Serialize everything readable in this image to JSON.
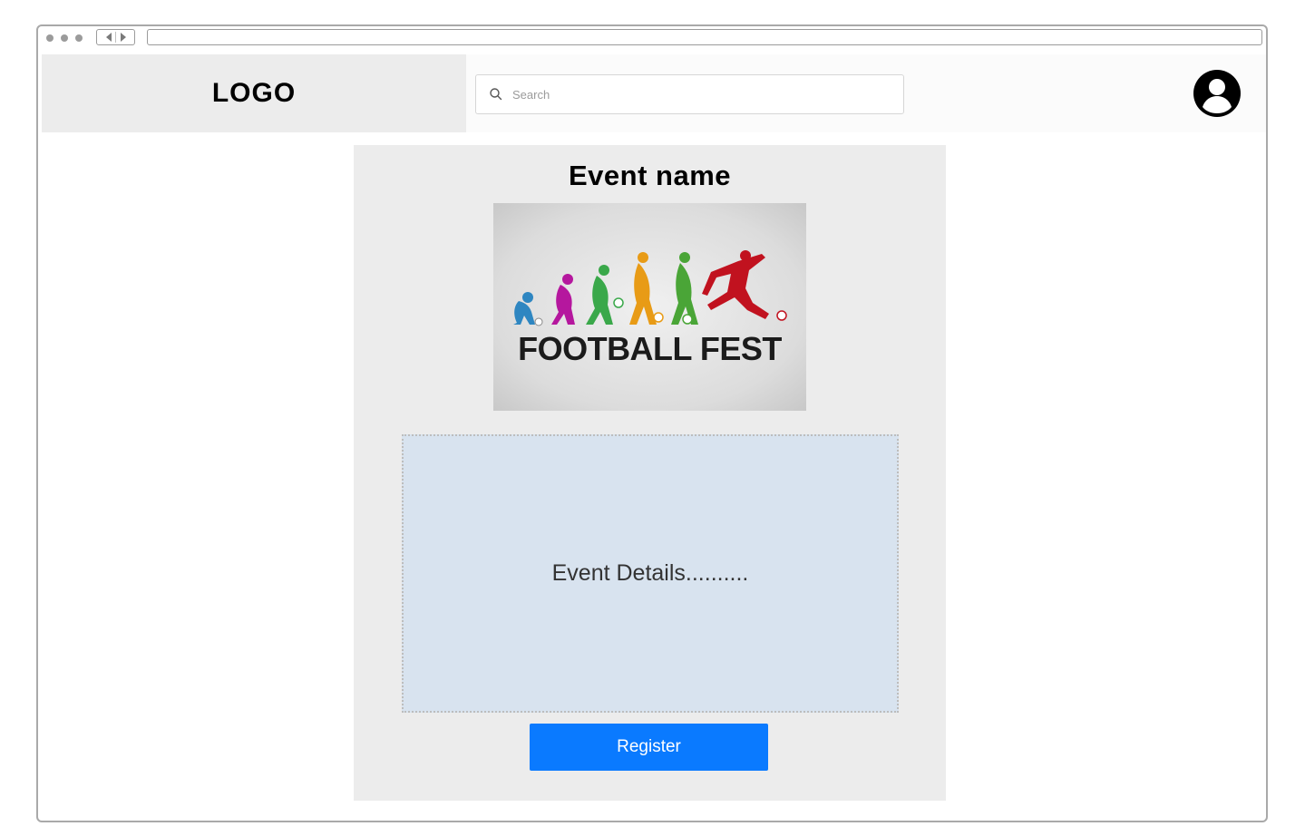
{
  "header": {
    "logo_text": "LOGO",
    "search_placeholder": "Search",
    "search_icon": "search-icon",
    "avatar_icon": "user-circle-icon"
  },
  "event": {
    "title": "Event name",
    "image_caption": "FOOTBALL FEST",
    "details": "Event Details..........",
    "register_label": "Register"
  },
  "colors": {
    "primary_button": "#0a7aff",
    "details_bg": "#d8e3ef",
    "card_bg": "#ececec",
    "figures": [
      "#2e86c1",
      "#b5179e",
      "#3aa84a",
      "#e89b16",
      "#4aa537",
      "#c1121f"
    ]
  }
}
